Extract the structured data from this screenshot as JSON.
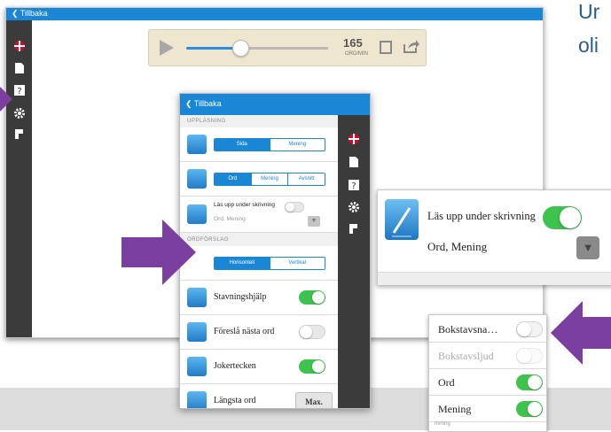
{
  "corner_text": {
    "line1": "Ur",
    "line2": "oli"
  },
  "main": {
    "back_label": "Tillbaka",
    "speed_value": "165",
    "speed_unit": "ORD/MIN"
  },
  "panel": {
    "back_label": "Tillbaka",
    "section_uppl": "UPPLÄSNING",
    "seg1": [
      "Sida",
      "Mening"
    ],
    "seg2": [
      "Ord",
      "Mening",
      "Avsnitt"
    ],
    "read_while_writing": "Läs upp under skrivning",
    "read_while_writing_value": "Ord, Mening",
    "section_ordf": "ORDFÖRSLAG",
    "seg3": [
      "Horisontell",
      "Vertikal"
    ],
    "rows": [
      {
        "label": "Stavningshjälp",
        "on": true
      },
      {
        "label": "Föreslå nästa ord",
        "on": false
      },
      {
        "label": "Jokertecken",
        "on": true
      },
      {
        "label": "Längsta ord",
        "button": "Max."
      }
    ]
  },
  "zoom1": {
    "label": "Läs upp under skrivning",
    "value": "Ord, Mening"
  },
  "zoom2": {
    "rows": [
      {
        "label": "Bokstavsna…",
        "on": false,
        "dim": false
      },
      {
        "label": "Bokstavsljud",
        "on": false,
        "dim": true
      },
      {
        "label": "Ord",
        "on": true,
        "dim": false
      },
      {
        "label": "Mening",
        "on": true,
        "dim": false
      }
    ],
    "tail": "rivning"
  },
  "colors": {
    "accent_blue": "#1a86d6",
    "toggle_green": "#3fc34f",
    "arrow_purple": "#7b3fa0",
    "sidebar_dark": "#3b3b3b"
  }
}
